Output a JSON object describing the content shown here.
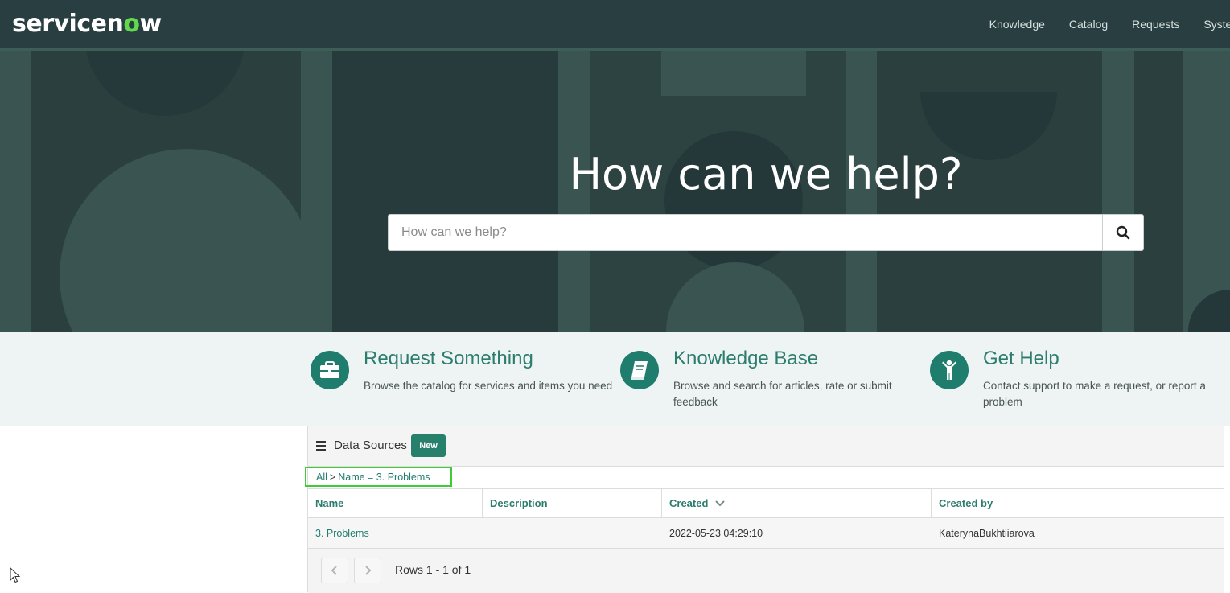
{
  "header": {
    "logo_text_before": "servicen",
    "logo_text_o": "o",
    "logo_text_after": "w",
    "nav": [
      "Knowledge",
      "Catalog",
      "Requests",
      "System"
    ]
  },
  "hero": {
    "title": "How can we help?",
    "search_placeholder": "How can we help?",
    "search_icon": "search-icon"
  },
  "features": [
    {
      "icon": "briefcase-icon",
      "title": "Request Something",
      "desc": "Browse the catalog for services and items you need"
    },
    {
      "icon": "book-icon",
      "title": "Knowledge Base",
      "desc": "Browse and search for articles, rate or submit feedback"
    },
    {
      "icon": "person-icon",
      "title": "Get Help",
      "desc": "Contact support to make a request, or report a problem"
    }
  ],
  "panel": {
    "title": "Data Sources",
    "new_label": "New",
    "breadcrumb": {
      "all": "All",
      "separator": ">",
      "filter": "Name = 3. Problems"
    },
    "columns": [
      "Name",
      "Description",
      "Created",
      "Created by"
    ],
    "sorted_column_icon": "chevron-down-icon",
    "rows": [
      {
        "name": "3. Problems",
        "description": "",
        "created": "2022-05-23 04:29:10",
        "created_by": "KaterynaBukhtiiarova"
      }
    ],
    "rows_text": "Rows 1 - 1 of 1"
  },
  "colors": {
    "header_bg": "#293e40",
    "hero_bg": "#2f4543",
    "accent": "#1f7d6e",
    "feature_strip_bg": "#edf4f3",
    "highlight_box": "#3fca3a"
  }
}
